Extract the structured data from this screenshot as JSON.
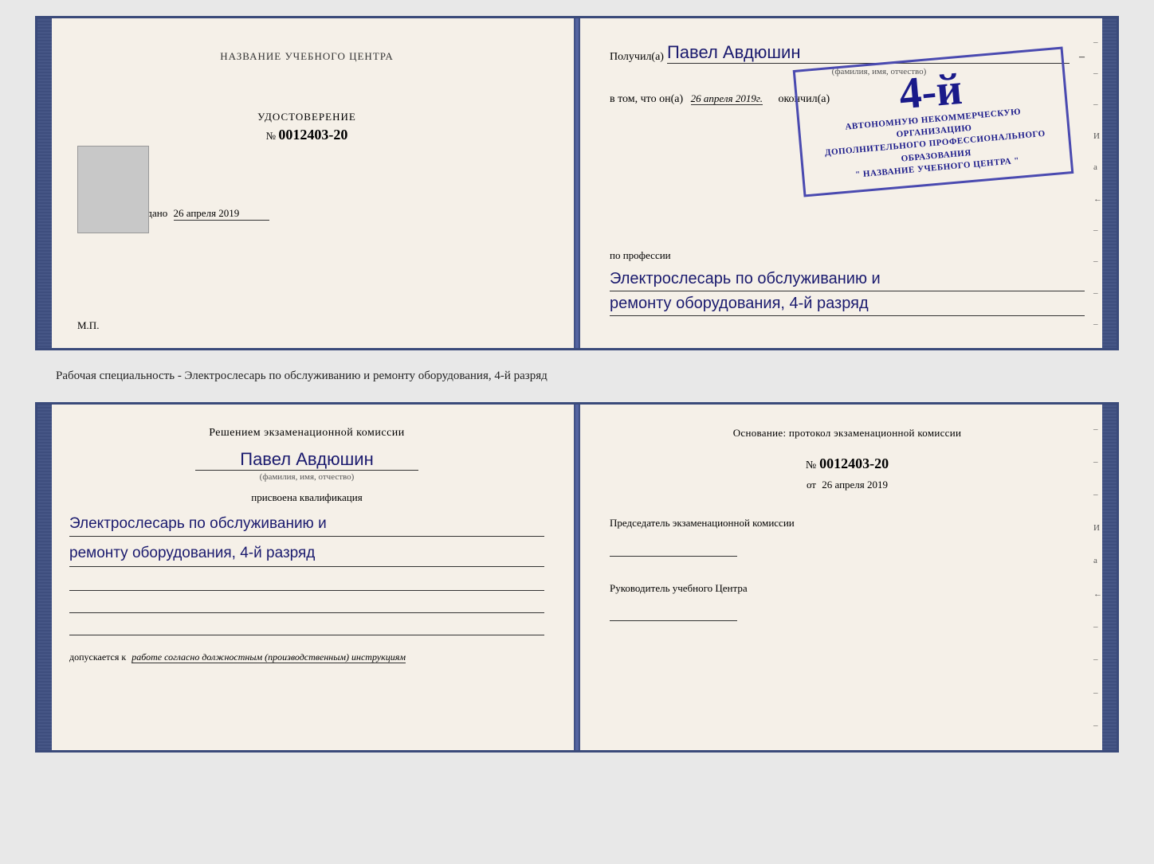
{
  "top_book": {
    "left": {
      "title": "НАЗВАНИЕ УЧЕБНОГО ЦЕНТРА",
      "photo_placeholder": "",
      "cert_label": "УДОСТОВЕРЕНИЕ",
      "cert_number_prefix": "№",
      "cert_number": "0012403-20",
      "issued_label": "Выдано",
      "issued_date": "26 апреля 2019",
      "mp_label": "М.П."
    },
    "right": {
      "recipient_prefix": "Получил(а)",
      "recipient_name": "Павел Авдюшин",
      "fio_label": "(фамилия, имя, отчество)",
      "vtom_text": "в том, что он(а)",
      "vtom_date": "26 апреля 2019г.",
      "okonchil": "окончил(а)",
      "stamp": {
        "number": "4-й",
        "line1": "АВТОНОМНУЮ НЕКОММЕРЧЕСКУЮ ОРГАНИЗАЦИЮ",
        "line2": "ДОПОЛНИТЕЛЬНОГО ПРОФЕССИОНАЛЬНОГО ОБРАЗОВАНИЯ",
        "line3": "\"   НАЗВАНИЕ УЧЕБНОГО ЦЕНТРА   \""
      },
      "po_professii": "по профессии",
      "profession_line1": "Электрослесарь по обслуживанию и",
      "profession_line2": "ремонту оборудования, 4-й разряд"
    }
  },
  "between_text": "Рабочая специальность - Электрослесарь по обслуживанию и ремонту оборудования, 4-й разряд",
  "bottom_book": {
    "left": {
      "decision_title": "Решением экзаменационной комиссии",
      "person_name": "Павел Авдюшин",
      "fio_label": "(фамилия, имя, отчество)",
      "prisvoena": "присвоена квалификация",
      "qualification_line1": "Электрослесарь по обслуживанию и",
      "qualification_line2": "ремонту оборудования, 4-й разряд",
      "dopuskaetsya_prefix": "допускается к",
      "dopuskaetsya_text": "работе согласно должностным (производственным) инструкциям"
    },
    "right": {
      "osnovanie_text": "Основание: протокол экзаменационной комиссии",
      "number_prefix": "№",
      "protocol_number": "0012403-20",
      "ot_prefix": "от",
      "ot_date": "26 апреля 2019",
      "chairman_title": "Председатель экзаменационной комиссии",
      "rukovoditel_title": "Руководитель учебного Центра"
    }
  },
  "side_dashes_right": [
    "–",
    "–",
    "–",
    "И",
    "а",
    "←",
    "–",
    "–",
    "–",
    "–"
  ]
}
